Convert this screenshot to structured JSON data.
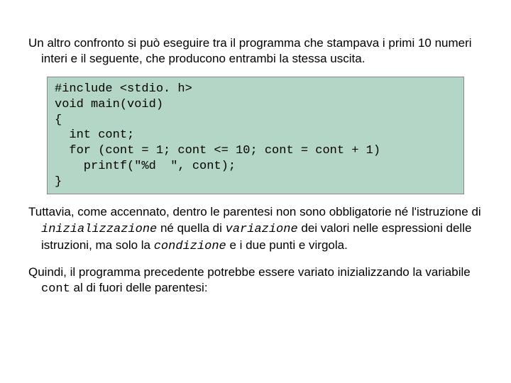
{
  "intro": "Un altro confronto si può eseguire tra il programma che stampava i primi 10 numeri interi e il seguente, che producono entrambi la stessa uscita.",
  "code": "#include <stdio. h>\nvoid main(void)\n{\n  int cont;\n  for (cont = 1; cont <= 10; cont = cont + 1)\n    printf(\"%d  \", cont);\n}",
  "p2_a": "Tuttavia, come accennato, dentro le parentesi non sono obbligatorie né l'istruzione di ",
  "p2_kw1": "inizializzazione",
  "p2_b": " né quella di ",
  "p2_kw2": "variazione",
  "p2_c": " dei valori nelle espressioni delle istruzioni, ma solo la ",
  "p2_kw3": "condizione",
  "p2_d": " e i due punti e virgola.",
  "p3_a": "Quindi, il programma precedente potrebbe essere variato inizializzando la variabile ",
  "p3_kw": "cont",
  "p3_b": " al di fuori delle parentesi:"
}
